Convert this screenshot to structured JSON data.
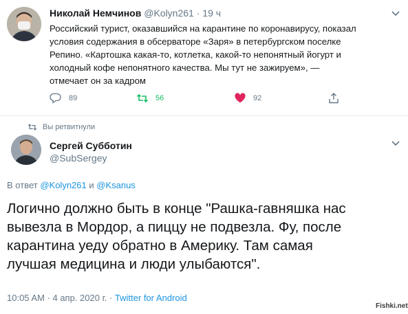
{
  "tweet1": {
    "author_name": "Николай Немчинов",
    "author_handle": "@Kolyn261",
    "separator": "·",
    "time": "19 ч",
    "text_lines": [
      "Российский турист, оказавшийся на карантине по коронавирусу, показал",
      "условия содержания в обсерваторе «Заря» в петербургском поселке",
      "Репино. «Картошка какая-то, котлетка, какой-то непонятный йогурт и",
      "холодный кофе непонятного качества. Мы тут не зажируем», —",
      "отмечает он за кадром"
    ],
    "replies": "89",
    "retweets": "56",
    "likes": "92",
    "colors": {
      "retweet": "#17bf63",
      "like": "#e0245e"
    },
    "icons": [
      "reply-icon",
      "retweet-icon",
      "heart-icon",
      "share-icon",
      "chevron-down-icon"
    ]
  },
  "retweeted_label": "Вы ретвитнули",
  "tweet2": {
    "author_name": "Сергей Субботин",
    "author_handle": "@SubSergey",
    "reply_prefix": "В ответ",
    "reply_mention1": "@Kolyn261",
    "reply_and": "и",
    "reply_mention2": "@Ksanus",
    "text_lines": [
      "Логично должно быть в конце \"Рашка-гавняшка нас",
      "вывезла в Мордор, а пиццу не подвезла. Фу, после",
      "карантина уеду обратно в Америку. Там самая",
      "лучшая медицина и люди улыбаются\"."
    ],
    "timestamp": "10:05 AM · 4 апр. 2020 г. ·",
    "app": "Twitter for Android"
  },
  "watermark": "Fishki.net"
}
